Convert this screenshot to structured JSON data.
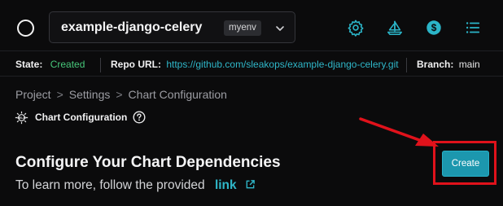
{
  "header": {
    "project_name": "example-django-celery",
    "env_badge": "myenv",
    "icons": [
      "logo-circle-icon",
      "settings-gear-icon",
      "sailboat-icon",
      "dollar-icon",
      "list-icon"
    ]
  },
  "info": {
    "state_label": "State:",
    "state_value": "Created",
    "repo_label": "Repo URL:",
    "repo_value": "https://github.com/sleakops/example-django-celery.git",
    "branch_label": "Branch:",
    "branch_value": "main"
  },
  "breadcrumb": {
    "items": [
      "Project",
      "Settings",
      "Chart Configuration"
    ],
    "separator": ">"
  },
  "section": {
    "label": "Chart Configuration",
    "icons": [
      "helm-icon",
      "help-icon"
    ]
  },
  "main": {
    "title": "Configure Your Chart Dependencies",
    "subtitle": "To learn more, follow the provided",
    "link_text": "link",
    "create_button": "Create"
  },
  "colors": {
    "background": "#0b0b0c",
    "accent_teal": "#1c97ae",
    "link_teal": "#2fb7c9",
    "state_green": "#47c77a",
    "annotation_red": "#e0121b"
  }
}
